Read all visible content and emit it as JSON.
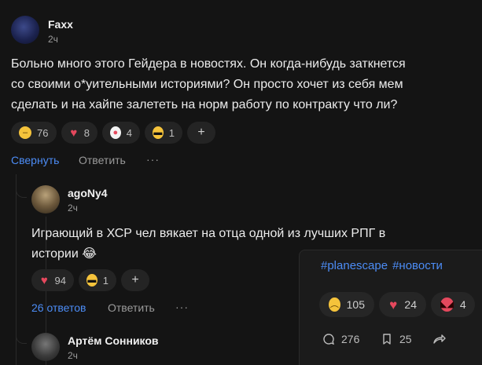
{
  "comment_main": {
    "author": "Faxx",
    "time": "2ч",
    "text_lines": [
      "Больно много этого Гейдера в новостях. Он когда-нибудь заткнется",
      "со своими о*уительными историями? Он просто хочет из себя мем",
      "сделать и на хайпе залететь на норм работу по контракту что ли?"
    ],
    "reactions": [
      {
        "icon": "neutral-face-icon",
        "count": "76"
      },
      {
        "icon": "heart-icon",
        "count": "8"
      },
      {
        "icon": "clown-icon",
        "count": "4"
      },
      {
        "icon": "sunglasses-icon",
        "count": "1"
      }
    ],
    "add_reaction": "+",
    "actions": {
      "collapse": "Свернуть",
      "reply": "Ответить",
      "more": "···"
    }
  },
  "comment_reply": {
    "author": "agoNy4",
    "time": "2ч",
    "text_lines": [
      "Играющий в ХСР чел вякает на отца одной из лучших РПГ в",
      "истории 😂"
    ],
    "reactions": [
      {
        "icon": "heart-icon",
        "count": "94"
      },
      {
        "icon": "sunglasses-icon",
        "count": "1"
      }
    ],
    "add_reaction": "+",
    "actions": {
      "replies": "26 ответов",
      "reply": "Ответить",
      "more": "···"
    }
  },
  "comment_third": {
    "author": "Артём Сонников",
    "time": "2ч"
  },
  "post_card": {
    "tags": [
      "#planescape",
      "#новости"
    ],
    "reactions": [
      {
        "icon": "sad-face-icon",
        "count": "105"
      },
      {
        "icon": "heart-icon",
        "count": "24"
      },
      {
        "icon": "angry-face-icon",
        "count": "4"
      }
    ],
    "comments_count": "276",
    "bookmarks_count": "25"
  },
  "colors": {
    "background": "#141414",
    "link": "#4c8cf5",
    "heart": "#e5485d",
    "emoji_yellow": "#f5c33b"
  }
}
